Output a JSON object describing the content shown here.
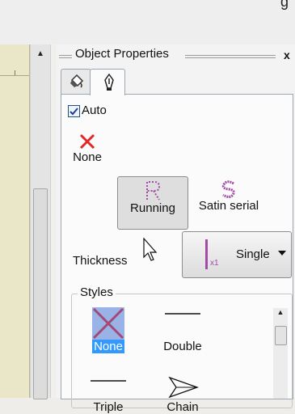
{
  "window": {
    "title": "Object Properties",
    "close_glyph": "x",
    "partial_text": "g"
  },
  "tabs": [
    {
      "name": "fill-tab",
      "icon": "paint-bucket-icon",
      "active": false
    },
    {
      "name": "outline-tab",
      "icon": "pen-nib-icon",
      "active": true
    }
  ],
  "auto": {
    "label": "Auto",
    "checked": true
  },
  "outline_types": [
    {
      "label": "None",
      "icon": "red-x-icon",
      "selected": false
    },
    {
      "label": "Running",
      "icon": "running-stitch-icon",
      "selected": true
    },
    {
      "label": "Satin serial",
      "icon": "satin-serial-icon",
      "selected": false
    }
  ],
  "thickness": {
    "label": "Thickness",
    "value": "Single",
    "badge": "x1",
    "accent": "#a24aa6"
  },
  "styles": {
    "title": "Styles",
    "items": [
      {
        "label": "None",
        "selected": true
      },
      {
        "label": "Double",
        "selected": false
      },
      {
        "label": "Triple",
        "selected": false
      },
      {
        "label": "Chain",
        "selected": false
      }
    ]
  },
  "colors": {
    "selection": "#3399ff",
    "none_red": "#e02828",
    "stitch_purple": "#a24aa6"
  }
}
